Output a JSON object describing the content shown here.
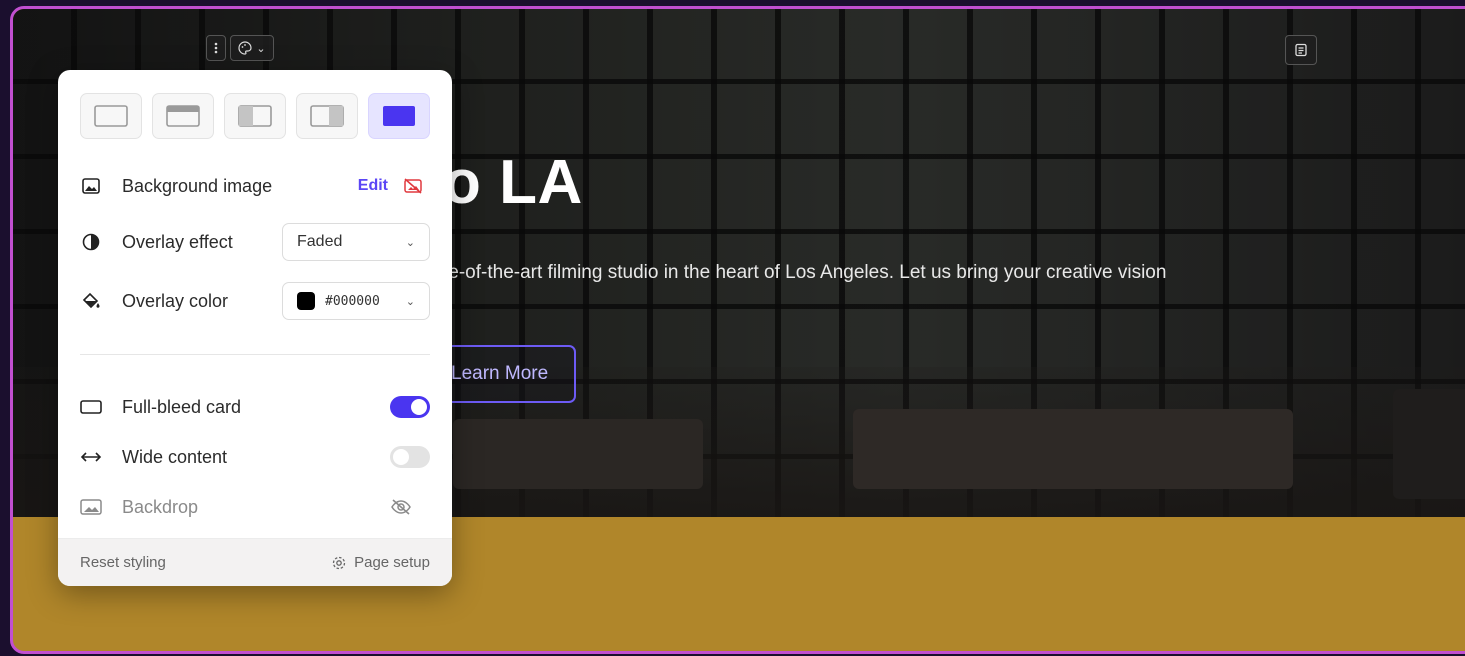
{
  "hero": {
    "title": "o LA",
    "subtitle": "te-of-the-art filming studio in the heart of Los Angeles. Let us bring your creative vision",
    "button_label": "Learn More"
  },
  "colors": {
    "accent": "#4a35f0",
    "frame_border": "#c14fd0",
    "section_below": "#b0862a"
  },
  "panel": {
    "layout_options": [
      {
        "icon": "layout-plain-icon",
        "selected": false
      },
      {
        "icon": "layout-header-icon",
        "selected": false
      },
      {
        "icon": "layout-left-image-icon",
        "selected": false
      },
      {
        "icon": "layout-right-image-icon",
        "selected": false
      },
      {
        "icon": "layout-full-bleed-icon",
        "selected": true
      }
    ],
    "background_image": {
      "label": "Background image",
      "edit_label": "Edit"
    },
    "overlay_effect": {
      "label": "Overlay effect",
      "value": "Faded"
    },
    "overlay_color": {
      "label": "Overlay color",
      "value": "#000000"
    },
    "full_bleed": {
      "label": "Full-bleed card",
      "enabled": true
    },
    "wide_content": {
      "label": "Wide content",
      "enabled": false
    },
    "backdrop": {
      "label": "Backdrop"
    },
    "footer": {
      "reset_label": "Reset styling",
      "page_setup_label": "Page setup"
    }
  }
}
